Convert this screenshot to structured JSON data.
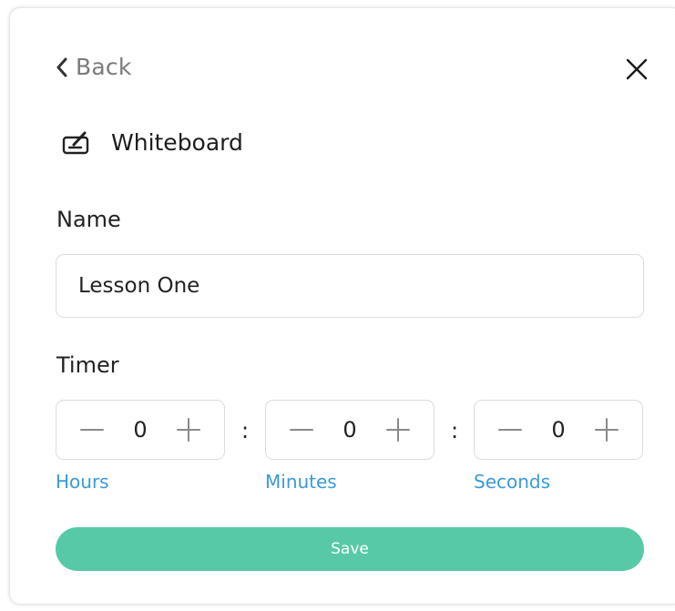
{
  "header": {
    "back_label": "Back",
    "title": "Whiteboard",
    "title_icon": "whiteboard-icon"
  },
  "form": {
    "name_label": "Name",
    "name_value": "Lesson One",
    "timer_label": "Timer",
    "hours": {
      "value": "0",
      "label": "Hours"
    },
    "minutes": {
      "value": "0",
      "label": "Minutes"
    },
    "seconds": {
      "value": "0",
      "label": "Seconds"
    },
    "separator": ":"
  },
  "actions": {
    "save_label": "Save"
  },
  "colors": {
    "accent": "#57c9a7",
    "link": "#3a9ad9",
    "text": "#222222",
    "muted": "#7a7a7a",
    "border": "#dcdcdc"
  }
}
